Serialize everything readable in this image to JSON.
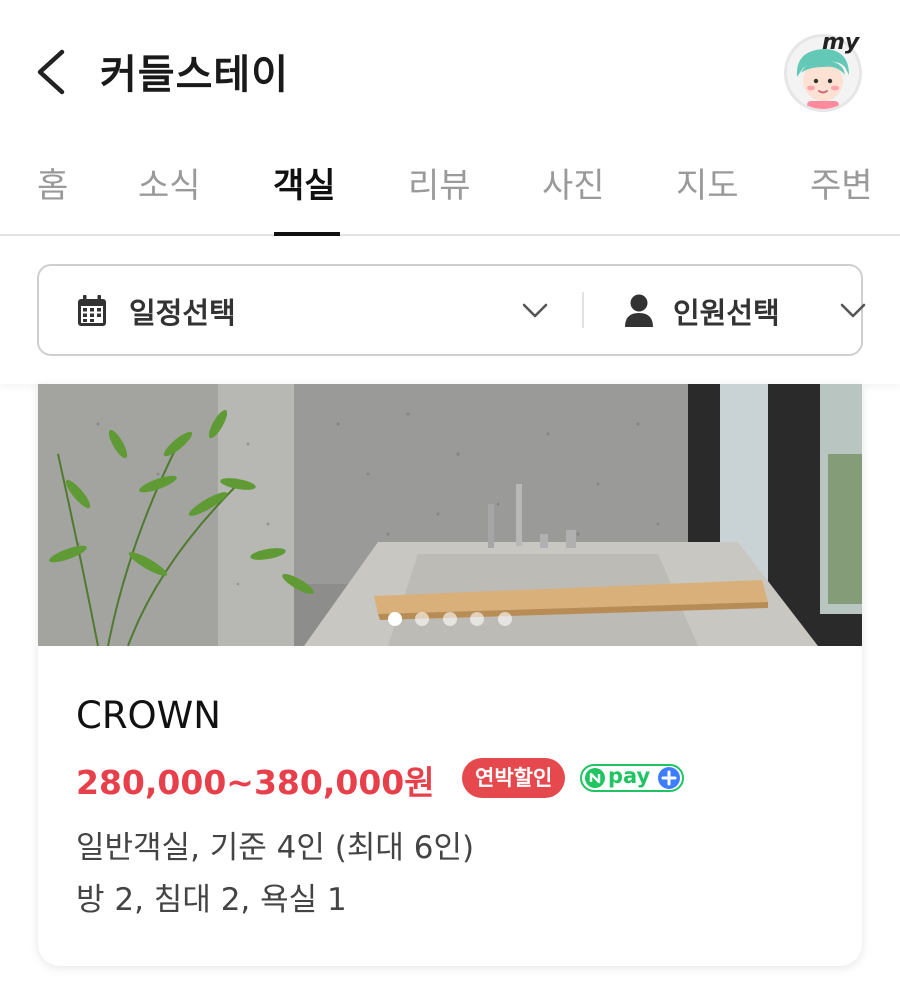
{
  "header": {
    "title": "커들스테이",
    "avatar_label": "my"
  },
  "tabs": [
    {
      "label": "홈",
      "active": false
    },
    {
      "label": "소식",
      "active": false
    },
    {
      "label": "객실",
      "active": true
    },
    {
      "label": "리뷰",
      "active": false
    },
    {
      "label": "사진",
      "active": false
    },
    {
      "label": "지도",
      "active": false
    },
    {
      "label": "주변",
      "active": false
    }
  ],
  "filters": {
    "date_label": "일정선택",
    "people_label": "인원선택"
  },
  "room": {
    "name": "CROWN",
    "price": "280,000~380,000원",
    "discount_badge": "연박할인",
    "npay_badge": "pay",
    "info_type": "일반객실, 기준 4인 (최대 6인)",
    "info_rooms": "방 2, 침대 2, 욕실 1",
    "photo_count": 5,
    "photo_active_index": 0
  },
  "colors": {
    "price": "#e8404a",
    "discount_badge": "#e5484d",
    "npay_green": "#20c463",
    "npay_plus_blue": "#3d7dff",
    "active_tab": "#111111"
  }
}
